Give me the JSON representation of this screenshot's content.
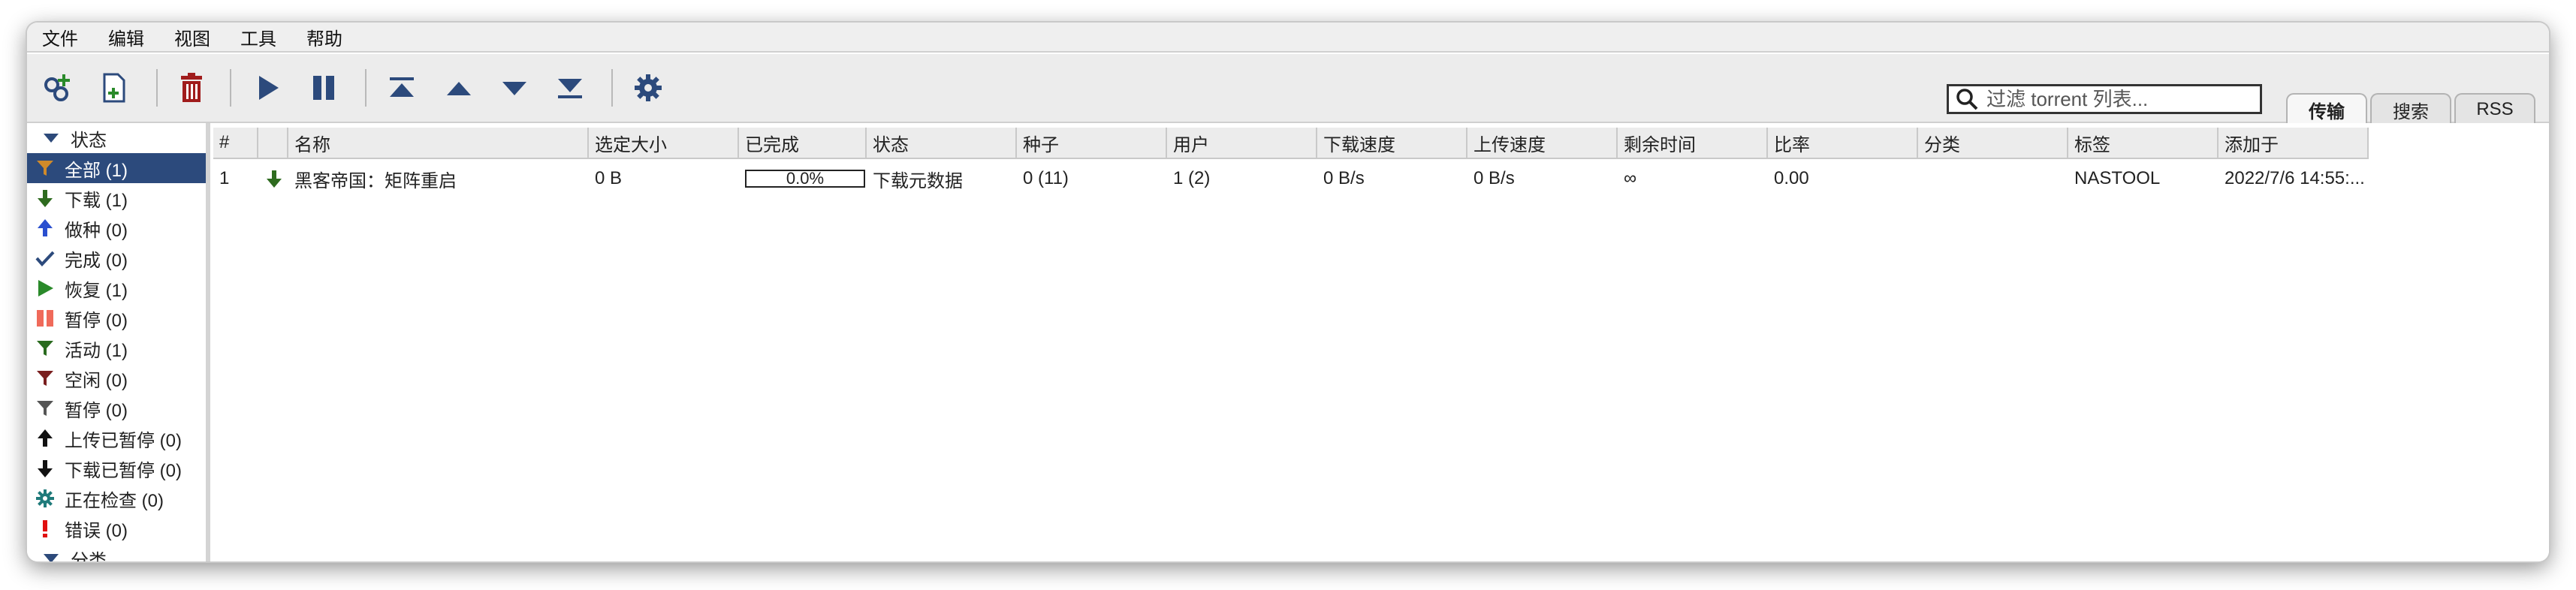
{
  "menu": [
    "文件",
    "编辑",
    "视图",
    "工具",
    "帮助"
  ],
  "toolbar": {
    "buttons": [
      "add-link-icon",
      "add-file-icon",
      "delete-icon",
      "resume-icon",
      "pause-icon",
      "move-top-icon",
      "move-up-icon",
      "move-down-icon",
      "move-bottom-icon",
      "settings-icon"
    ],
    "search_placeholder": "过滤 torrent 列表..."
  },
  "tabs": [
    "传输",
    "搜索",
    "RSS"
  ],
  "sidebar": {
    "status_header": "状态",
    "items": [
      {
        "label": "全部 (1)",
        "icon": "filter-icon",
        "color": "#d08a2a"
      },
      {
        "label": "下载 (1)",
        "icon": "arrow-down-icon",
        "color": "#2e6b1f"
      },
      {
        "label": "做种 (0)",
        "icon": "arrow-up-icon",
        "color": "#2a4fcf"
      },
      {
        "label": "完成 (0)",
        "icon": "check-icon",
        "color": "#2c4a7c"
      },
      {
        "label": "恢复 (1)",
        "icon": "play-icon",
        "color": "#2a8a2a"
      },
      {
        "label": "暂停 (0)",
        "icon": "pause-icon",
        "color": "#f06a5a"
      },
      {
        "label": "活动 (1)",
        "icon": "filter-icon",
        "color": "#2a6b1f"
      },
      {
        "label": "空闲 (0)",
        "icon": "filter-icon",
        "color": "#7a1f1f"
      },
      {
        "label": "暂停 (0)",
        "icon": "filter-icon",
        "color": "#555555"
      },
      {
        "label": "上传已暂停 (0)",
        "icon": "arrow-up-icon",
        "color": "#111111"
      },
      {
        "label": "下载已暂停 (0)",
        "icon": "arrow-down-icon",
        "color": "#111111"
      },
      {
        "label": "正在检查 (0)",
        "icon": "gear-icon",
        "color": "#1f7a7a"
      },
      {
        "label": "错误 (0)",
        "icon": "exclamation-icon",
        "color": "#e01010"
      }
    ],
    "category_header": "分类"
  },
  "table": {
    "columns": [
      "#",
      "",
      "名称",
      "选定大小",
      "已完成",
      "状态",
      "种子",
      "用户",
      "下载速度",
      "上传速度",
      "剩余时间",
      "比率",
      "分类",
      "标签",
      "添加于"
    ],
    "rows": [
      {
        "num": "1",
        "name": "黑客帝国：矩阵重启",
        "size": "0 B",
        "done": "0.0%",
        "done_value": 0.0,
        "status": "下载元数据",
        "seeds": "0 (11)",
        "peers": "1 (2)",
        "dl_speed": "0 B/s",
        "ul_speed": "0 B/s",
        "eta": "∞",
        "ratio": "0.00",
        "category": "",
        "tags": "NASTOOL",
        "added": "2022/7/6 14:55:..."
      }
    ]
  }
}
